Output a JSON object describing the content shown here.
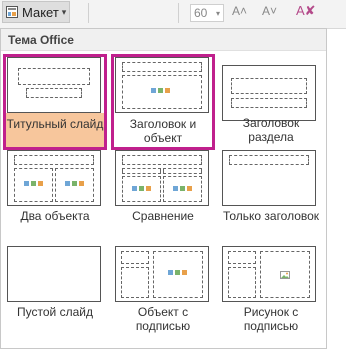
{
  "ribbon": {
    "layout_label": "Макет",
    "layout_caret": "▾",
    "font_size": "60",
    "font_size_caret": "▾",
    "grow_font": "A˄",
    "shrink_font": "A˅",
    "clear_formatting": "A✘"
  },
  "gallery": {
    "header": "Тема Office",
    "items": [
      {
        "label": "Титульный слайд"
      },
      {
        "label": "Заголовок и объект"
      },
      {
        "label": "Заголовок раздела"
      },
      {
        "label": "Два объекта"
      },
      {
        "label": "Сравнение"
      },
      {
        "label": "Только заголовок"
      },
      {
        "label": "Пустой слайд"
      },
      {
        "label": "Объект с подписью"
      },
      {
        "label": "Рисунок с подписью"
      }
    ]
  },
  "colors": {
    "accent_border": "#c0208d",
    "selected_caption_bg": "#f7c69c"
  }
}
